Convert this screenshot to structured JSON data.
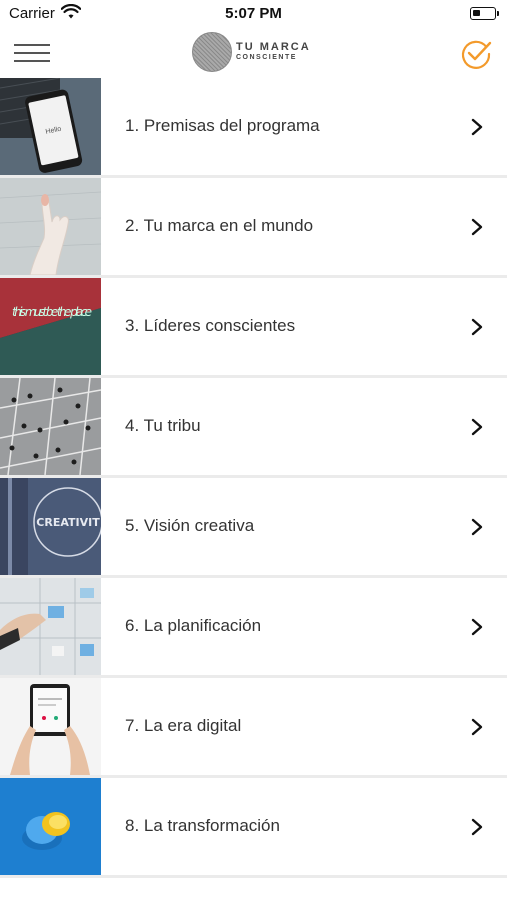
{
  "status_bar": {
    "carrier": "Carrier",
    "time": "5:07 PM",
    "battery_level": 0.35
  },
  "header": {
    "menu_icon": "hamburger-menu-icon",
    "logo_line1": "TU MARCA",
    "logo_line2": "CONSCIENTE",
    "action_icon": "check-circle-icon",
    "accent_color": "#f39a2b"
  },
  "items": [
    {
      "label": "1. Premisas del programa",
      "thumb_icon": "phone-hello-photo"
    },
    {
      "label": "2. Tu marca en el mundo",
      "thumb_icon": "hand-photo"
    },
    {
      "label": "3. Líderes conscientes",
      "thumb_icon": "neon-sign-photo",
      "thumb_text": "this must be the place"
    },
    {
      "label": "4. Tu tribu",
      "thumb_icon": "crowd-aerial-photo"
    },
    {
      "label": "5. Visión creativa",
      "thumb_icon": "creativity-sign-photo",
      "thumb_text": "CREATIVIT"
    },
    {
      "label": "6. La planificación",
      "thumb_icon": "planning-board-photo"
    },
    {
      "label": "7. La era digital",
      "thumb_icon": "tablet-hands-photo"
    },
    {
      "label": "8. La transformación",
      "thumb_icon": "egg-blue-photo"
    }
  ]
}
